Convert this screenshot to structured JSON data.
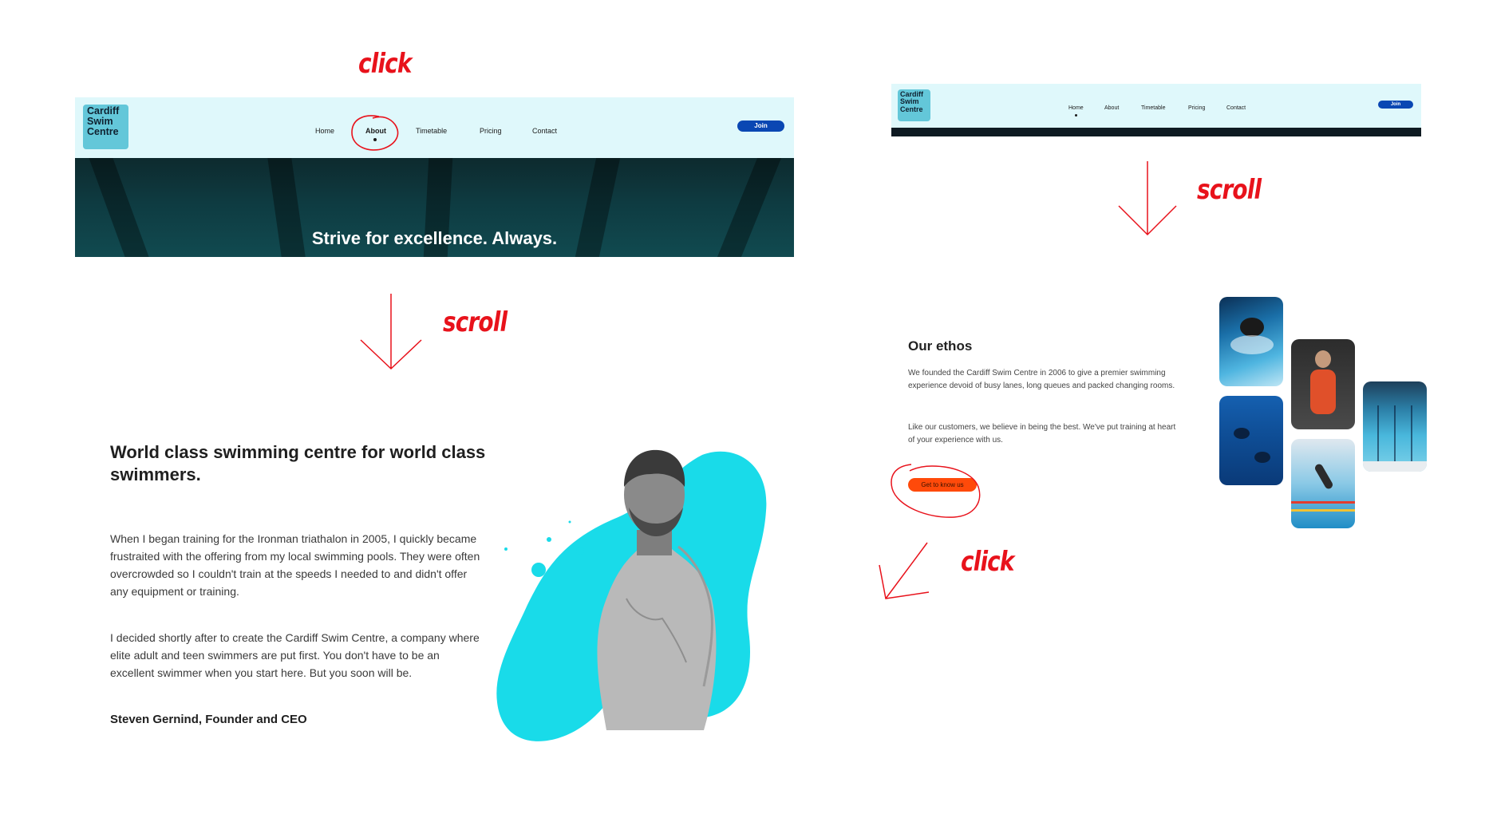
{
  "annotations": {
    "click1": "click",
    "scroll1": "scroll",
    "scroll2": "scroll",
    "click2": "click"
  },
  "nav": {
    "logo_line1": "Cardiff",
    "logo_line2": "Swim",
    "logo_line3": "Centre",
    "items": [
      "Home",
      "About",
      "Timetable",
      "Pricing",
      "Contact"
    ],
    "join_label": "Join"
  },
  "hero": {
    "title": "Strive for excellence. Always."
  },
  "about": {
    "heading": "World class swimming centre for world class swimmers.",
    "paragraph1": "When I began training for the Ironman triathalon in 2005, I quickly became frustraited with the offering from my local swimming pools. They were often overcrowded so I couldn't train at the speeds I needed to and didn't offer any equipment or training.",
    "paragraph2": "I decided shortly after to create the Cardiff Swim Centre, a company where elite adult and teen swimmers are put first. You don't have to be an excellent swimmer when you start here. But you soon will be.",
    "signature": "Steven Gernind, Founder and CEO"
  },
  "ethos": {
    "heading": "Our ethos",
    "paragraph1": "We founded the Cardiff Swim Centre in 2006 to give a premier swimming experience devoid of busy lanes, long queues and packed changing rooms.",
    "paragraph2": "Like our customers, we believe in being the best. We've put training at heart of your experience with us.",
    "cta_label": "Get to know us"
  },
  "colors": {
    "nav_bg": "#dff8fb",
    "logo_bg": "#63c7d9",
    "join_btn": "#0a47b3",
    "cta_btn": "#ff4a0a",
    "blob": "#19dbe9",
    "annotation": "#e8121b"
  }
}
